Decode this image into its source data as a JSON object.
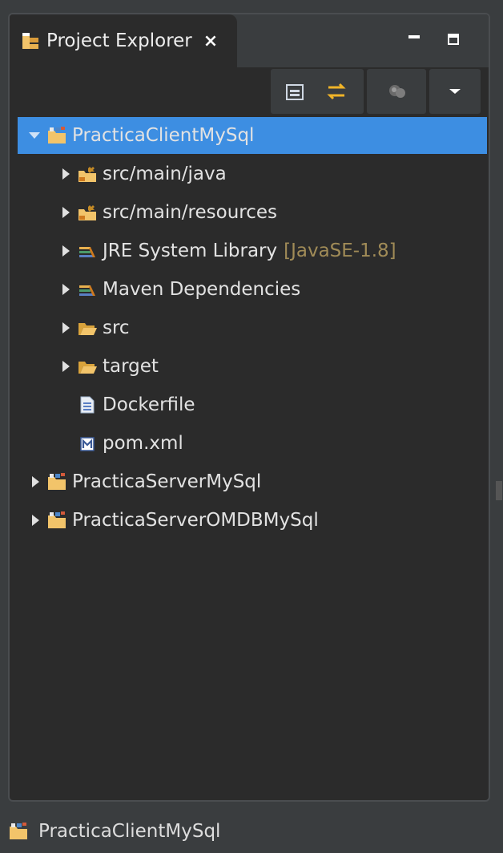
{
  "view": {
    "title": "Project Explorer",
    "close_glyph": "×"
  },
  "toolbar": {
    "buttons": [
      "collapse-all-icon",
      "link-with-editor-icon",
      "filter-icon",
      "view-menu-icon"
    ]
  },
  "tree": [
    {
      "label": "PracticaClientMySql",
      "decoration": "",
      "icon": "java-project-icon",
      "expand": "down",
      "level": 0,
      "selected": true
    },
    {
      "label": "src/main/java",
      "decoration": "",
      "icon": "source-folder-icon",
      "expand": "right",
      "level": 1
    },
    {
      "label": "src/main/resources",
      "decoration": "",
      "icon": "source-folder-icon",
      "expand": "right",
      "level": 1
    },
    {
      "label": "JRE System Library",
      "decoration": "[JavaSE-1.8]",
      "icon": "library-icon",
      "expand": "right",
      "level": 1
    },
    {
      "label": "Maven Dependencies",
      "decoration": "",
      "icon": "library-icon",
      "expand": "right",
      "level": 1
    },
    {
      "label": "src",
      "decoration": "",
      "icon": "folder-icon",
      "expand": "right",
      "level": 1
    },
    {
      "label": "target",
      "decoration": "",
      "icon": "folder-icon",
      "expand": "right",
      "level": 1
    },
    {
      "label": "Dockerfile",
      "decoration": "",
      "icon": "file-icon",
      "expand": "none",
      "level": 1
    },
    {
      "label": "pom.xml",
      "decoration": "",
      "icon": "maven-file-icon",
      "expand": "none",
      "level": 1
    },
    {
      "label": "PracticaServerMySql",
      "decoration": "",
      "icon": "java-project-icon",
      "expand": "right",
      "level": 0
    },
    {
      "label": "PracticaServerOMDBMySql",
      "decoration": "",
      "icon": "java-project-icon",
      "expand": "right",
      "level": 0
    }
  ],
  "status": {
    "text": "PracticaClientMySql"
  },
  "colors": {
    "selection": "#3d8ee2",
    "background": "#2b2b2b",
    "decoration": "#a08b57"
  }
}
